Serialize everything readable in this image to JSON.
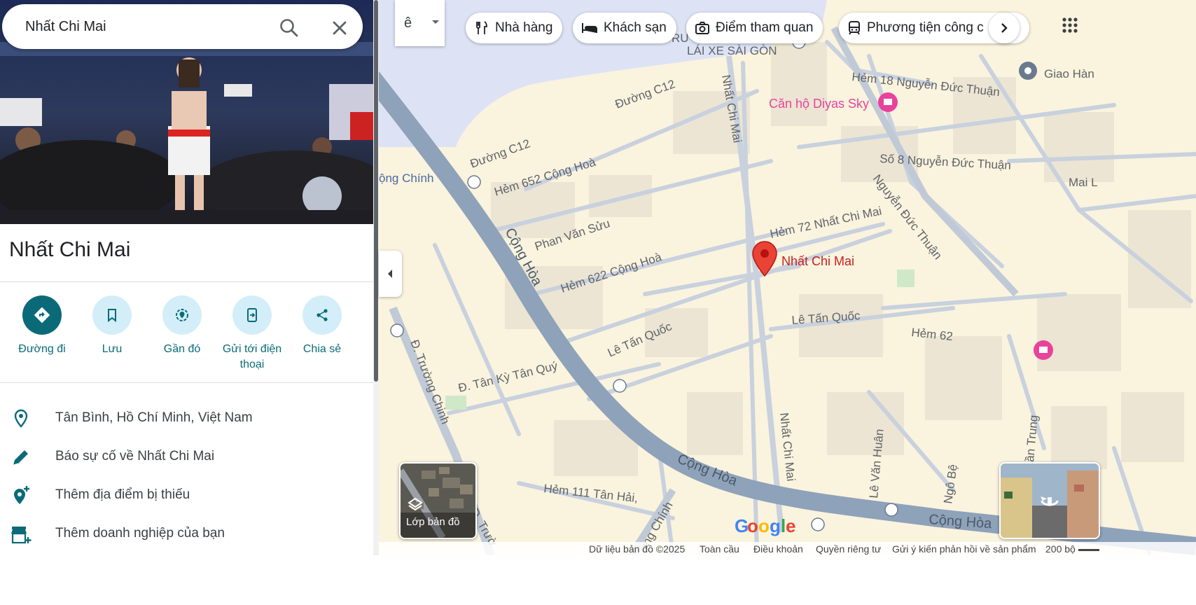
{
  "search": {
    "query": "Nhất Chi Mai"
  },
  "place": {
    "title": "Nhất Chi Mai"
  },
  "actions": [
    {
      "label": "Đường đi"
    },
    {
      "label": "Lưu"
    },
    {
      "label": "Gần đó"
    },
    {
      "label": "Gửi tới điện thoại"
    },
    {
      "label": "Chia sẻ"
    }
  ],
  "info": [
    {
      "text": "Tân Bình, Hồ Chí Minh, Việt Nam",
      "icon": "location-pin-icon"
    },
    {
      "text": "Báo sự cố về Nhất Chi Mai",
      "icon": "pencil-icon"
    },
    {
      "text": "Thêm địa điểm bị thiếu",
      "icon": "add-location-icon"
    },
    {
      "text": "Thêm doanh nghiệp của bạn",
      "icon": "add-business-icon"
    }
  ],
  "map": {
    "mode_label": "ê",
    "chips": [
      {
        "label": "Nhà hàng",
        "icon": "restaurant-icon"
      },
      {
        "label": "Khách sạn",
        "icon": "hotel-icon"
      },
      {
        "label": "Điểm tham quan",
        "icon": "camera-icon"
      },
      {
        "label": "Phương tiện công c",
        "icon": "transit-icon"
      }
    ],
    "labels": {
      "lai_xe": "LÁI XE SÀI GÒN",
      "duong_c12_a": "Đường C12",
      "duong_c12_b": "Đường C12",
      "hem652": "Hẻm 652 Cộng Hoà",
      "phan_van_suu": "Phan Văn Sửu",
      "hem622": "Hẻm 622 Cộng Hoà",
      "cong_hoa_diag": "Cộng Hòa",
      "cong_hoa_bottom_a": "Cộng Hòa",
      "cong_hoa_bottom_b": "Cộng Hòa",
      "cong_chinh": "ộng Chính",
      "nhat_chi_mai_top": "Nhất Chi Mai",
      "nhat_chi_mai_bottom": "Nhất Chi Mai",
      "hem72": "Hẻm 72 Nhất Chi Mai",
      "nhat_chi_mai_marker": "Nhất Chi Mai",
      "le_tan_quoc_a": "Lê Tấn Quốc",
      "le_tan_quoc_b": "Lê Tấn Quốc",
      "tan_ky_tan_quy": "Đ. Tân Kỳ Tân Quý",
      "truong_chinh": "Đ. Trường Chinh",
      "truong_chinh_b": "Đ. Trườ",
      "truong_chinh_c": "ờng Chính",
      "hem111": "Hẻm 111 Tân Hải,",
      "hem18": "Hẻm 18 Nguyễn Đức Thuận",
      "can_ho": "Căn hộ Diyas Sky",
      "so8": "Số 8 Nguyễn Đức Thuận",
      "nguyen_duc_thuan": "Nguyễn Đức Thuận",
      "hem62": "Hẻm 62",
      "le_van_huan": "Lê Văn Huân",
      "ngo_be": "Ngô Bệ",
      "an_trung": "ần Trung",
      "giao_han": "Giao Hàn",
      "mai_l": "Mai L",
      "ru": "RU"
    },
    "layers_label": "Lớp bản đồ",
    "footer": {
      "data": "Dữ liệu bản đồ ©2025",
      "global": "Toàn cầu",
      "terms": "Điều khoản",
      "privacy": "Quyền riêng tư",
      "feedback": "Gửi ý kiến phản hồi về sản phẩm",
      "scale": "200 bộ"
    },
    "colors": {
      "marker": "#ea4335",
      "major_road": "#8ea2b9",
      "water": "#dde3f5",
      "poi_pink": "#e8439a",
      "primary_teal": "#0b6a78"
    }
  }
}
